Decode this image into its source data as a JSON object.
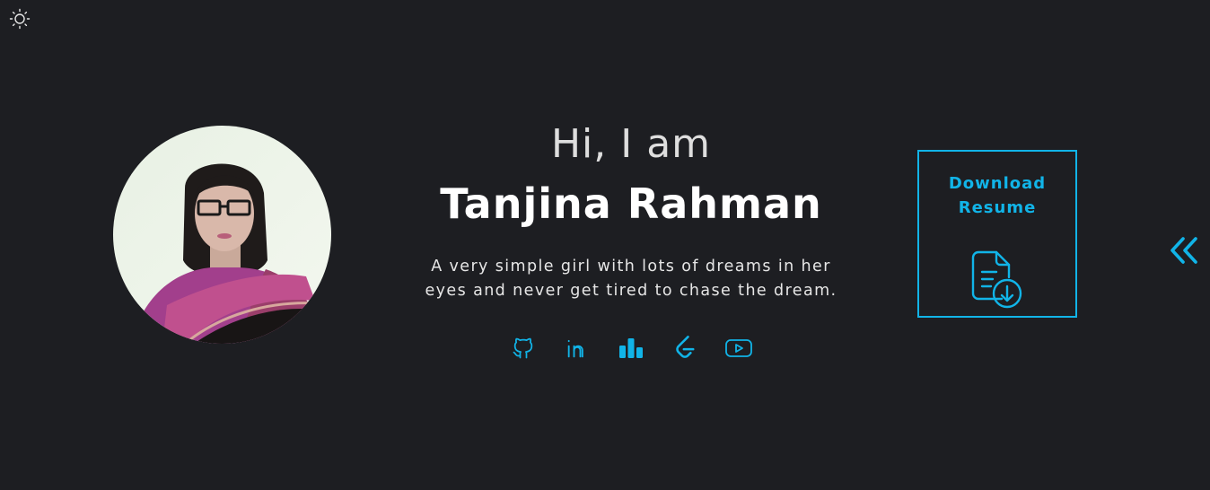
{
  "theme": {
    "accent": "#11b4e8",
    "background": "#1d1e22",
    "toggle_icon": "sun-icon"
  },
  "hero": {
    "greeting": "Hi, I am",
    "name": "Tanjina Rahman",
    "bio": "A very simple girl with lots of dreams in her eyes and never get tired to chase the dream."
  },
  "avatar": {
    "alt": "Tanjina Rahman"
  },
  "socials": [
    {
      "name": "github-icon"
    },
    {
      "name": "linkedin-icon"
    },
    {
      "name": "stats-icon"
    },
    {
      "name": "leetcode-icon"
    },
    {
      "name": "youtube-icon"
    }
  ],
  "resume": {
    "label_line1": "Download",
    "label_line2": "Resume",
    "icon": "file-download-icon"
  },
  "nav": {
    "icon": "double-chevron-left-icon"
  }
}
